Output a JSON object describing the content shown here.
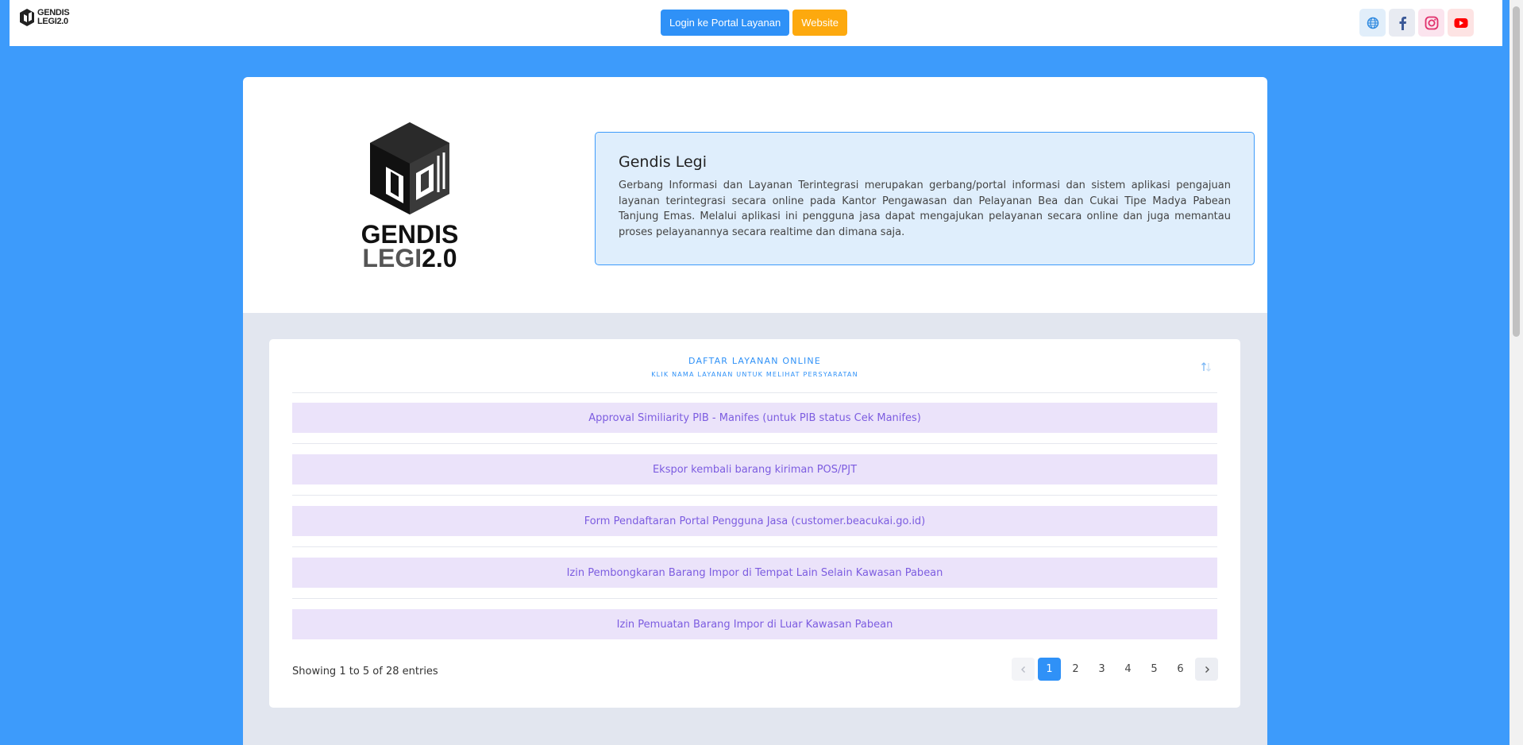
{
  "topbar": {
    "brand_line1": "GENDIS",
    "brand_line2": "LEGI2.0",
    "login_label": "Login ke Portal Layanan",
    "website_label": "Website",
    "social": [
      "globe-icon",
      "facebook-icon",
      "instagram-icon",
      "youtube-icon"
    ]
  },
  "hero": {
    "logo_word1": "GENDIS",
    "logo_word2a": "LEGI",
    "logo_word2b": "2.0",
    "title": "Gendis Legi",
    "description": "Gerbang Informasi dan Layanan Terintegrasi merupakan gerbang/portal informasi dan sistem aplikasi pengajuan layanan terintegrasi secara online pada Kantor Pengawasan dan Pelayanan Bea dan Cukai Tipe Madya Pabean Tanjung Emas. Melalui aplikasi ini pengguna jasa dapat mengajukan pelayanan secara online dan juga memantau proses pelayanannya secara realtime dan dimana saja."
  },
  "services": {
    "title": "DAFTAR LAYANAN ONLINE",
    "subtitle": "KLIK NAMA LAYANAN UNTUK MELIHAT PERSYARATAN",
    "items": [
      "Approval Similiarity PIB - Manifes (untuk PIB status Cek Manifes)",
      "Ekspor kembali barang kiriman POS/PJT",
      "Form Pendaftaran Portal Pengguna Jasa (customer.beacukai.go.id)",
      "Izin Pembongkaran Barang Impor di Tempat Lain Selain Kawasan Pabean",
      "Izin Pemuatan Barang Impor di Luar Kawasan Pabean"
    ],
    "showing": "Showing 1 to 5 of 28 entries",
    "pages": [
      "1",
      "2",
      "3",
      "4",
      "5",
      "6"
    ],
    "active_page": "1"
  },
  "colors": {
    "background": "#3d9bfb",
    "primary": "#2f91f7",
    "warning": "#fda90e",
    "item_bg": "#ebe3fa",
    "item_text": "#7c5ce0"
  }
}
